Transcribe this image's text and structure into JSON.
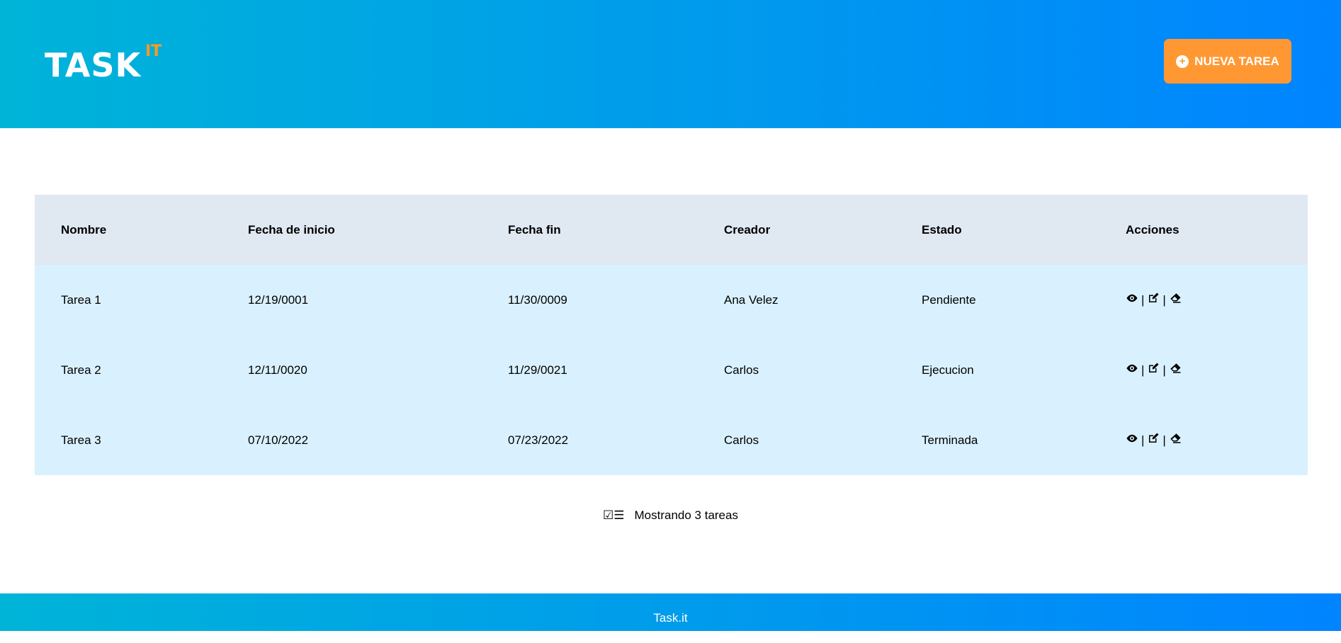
{
  "header": {
    "logo_text": "TASK",
    "logo_sup": "IT",
    "new_task_label": "NUEVA TAREA"
  },
  "table": {
    "headers": [
      "Nombre",
      "Fecha de inicio",
      "Fecha fin",
      "Creador",
      "Estado",
      "Acciones"
    ],
    "rows": [
      [
        "Tarea 1",
        "12/19/0001",
        "11/30/0009",
        "Ana Velez",
        "Pendiente"
      ],
      [
        "Tarea 2",
        "12/11/0020",
        "11/29/0021",
        "Carlos",
        "Ejecucion"
      ],
      [
        "Tarea 3",
        "07/10/2022",
        "07/23/2022",
        "Carlos",
        "Terminada"
      ]
    ],
    "separator": "|"
  },
  "summary": "Mostrando 3 tareas",
  "footer": "Task.it",
  "colors": {
    "accent": "#ff9833",
    "header_start": "#00b4d8",
    "header_end": "#0084ff",
    "row_bg": "#d9f1fe",
    "head_bg": "#e0e8f2"
  }
}
